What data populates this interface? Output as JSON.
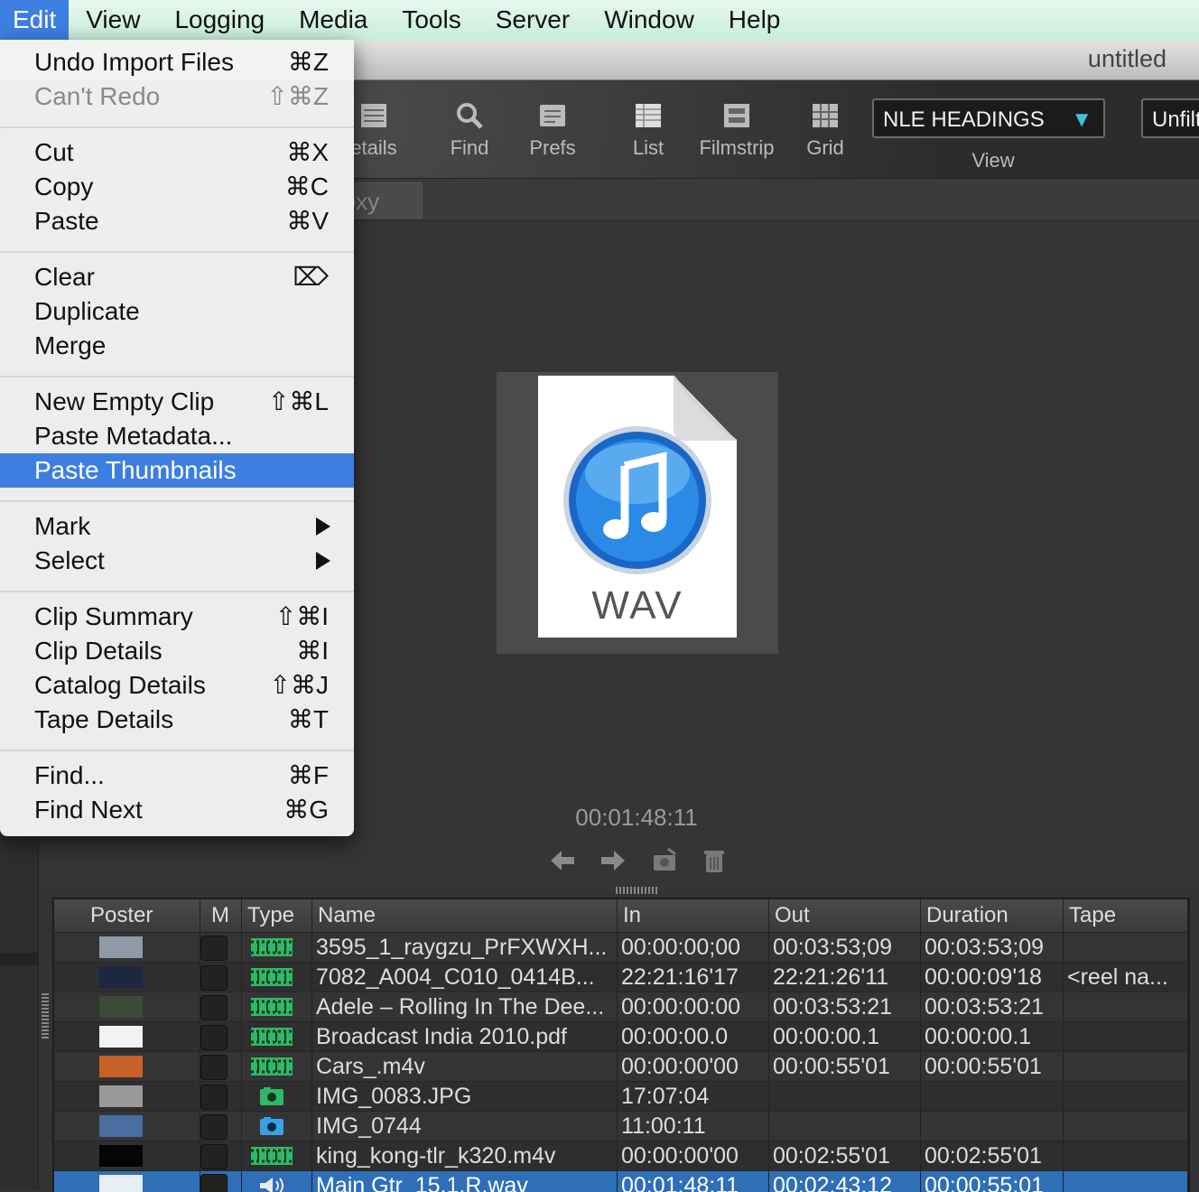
{
  "menubar": {
    "items": [
      "Edit",
      "View",
      "Logging",
      "Media",
      "Tools",
      "Server",
      "Window",
      "Help"
    ]
  },
  "window": {
    "title": "untitled"
  },
  "toolbar": {
    "tools": [
      {
        "label": "etails",
        "icon": "details-icon"
      },
      {
        "label": "Find",
        "icon": "find-icon"
      },
      {
        "label": "Prefs",
        "icon": "prefs-icon"
      },
      {
        "label": "List",
        "icon": "list-icon"
      },
      {
        "label": "Filmstrip",
        "icon": "filmstrip-icon"
      },
      {
        "label": "Grid",
        "icon": "grid-icon"
      }
    ],
    "view_select": "NLE HEADINGS",
    "view_label": "View",
    "unfilter": "Unfilt"
  },
  "tabs": {
    "proxy": "roxy"
  },
  "preview": {
    "file_type": "WAV",
    "timecode": "00:01:48:11"
  },
  "edit_menu": {
    "items": [
      {
        "label": "Undo Import Files",
        "shortcut": "⌘Z"
      },
      {
        "label": "Can't Redo",
        "shortcut": "⇧⌘Z",
        "disabled": true
      },
      {
        "label": "Cut",
        "shortcut": "⌘X"
      },
      {
        "label": "Copy",
        "shortcut": "⌘C"
      },
      {
        "label": "Paste",
        "shortcut": "⌘V"
      },
      {
        "label": "Clear",
        "shortcut": "⌦"
      },
      {
        "label": "Duplicate",
        "shortcut": ""
      },
      {
        "label": "Merge",
        "shortcut": ""
      },
      {
        "label": "New Empty Clip",
        "shortcut": "⇧⌘L"
      },
      {
        "label": "Paste Metadata...",
        "shortcut": ""
      },
      {
        "label": "Paste Thumbnails",
        "shortcut": "",
        "highlighted": true
      },
      {
        "label": "Mark",
        "submenu": true
      },
      {
        "label": "Select",
        "submenu": true
      },
      {
        "label": "Clip Summary",
        "shortcut": "⇧⌘I"
      },
      {
        "label": "Clip Details",
        "shortcut": "⌘I"
      },
      {
        "label": "Catalog Details",
        "shortcut": "⇧⌘J"
      },
      {
        "label": "Tape Details",
        "shortcut": "⌘T"
      },
      {
        "label": "Find...",
        "shortcut": "⌘F"
      },
      {
        "label": "Find Next",
        "shortcut": "⌘G"
      }
    ]
  },
  "table": {
    "columns": [
      "Poster",
      "M",
      "Type",
      "Name",
      "In",
      "Out",
      "Duration",
      "Tape"
    ],
    "rows": [
      {
        "name": "3595_1_raygzu_PrFXWXH...",
        "in": "00:00:00;00",
        "out": "00:03:53;09",
        "duration": "00:03:53;09",
        "tape": "",
        "type": "video",
        "poster": "#8e9aa8"
      },
      {
        "name": "7082_A004_C010_0414B...",
        "in": "22:21:16'17",
        "out": "22:21:26'11",
        "duration": "00:00:09'18",
        "tape": "<reel na...",
        "type": "video",
        "poster": "#1d2740"
      },
      {
        "name": "Adele – Rolling In The Dee...",
        "in": "00:00:00:00",
        "out": "00:03:53:21",
        "duration": "00:03:53:21",
        "tape": "",
        "type": "video",
        "poster": "#3c4a38"
      },
      {
        "name": "Broadcast India 2010.pdf",
        "in": "00:00:00.0",
        "out": "00:00:00.1",
        "duration": "00:00:00.1",
        "tape": "",
        "type": "video",
        "poster": "#f2f2f2"
      },
      {
        "name": "Cars_.m4v",
        "in": "00:00:00'00",
        "out": "00:00:55'01",
        "duration": "00:00:55'01",
        "tape": "",
        "type": "video",
        "poster": "#c8602a"
      },
      {
        "name": "IMG_0083.JPG",
        "in": "17:07:04",
        "out": "",
        "duration": "",
        "tape": "",
        "type": "photo",
        "poster": "#9a9a9a"
      },
      {
        "name": "IMG_0744",
        "in": "11:00:11",
        "out": "",
        "duration": "",
        "tape": "",
        "type": "photo-blue",
        "poster": "#4a6ea0"
      },
      {
        "name": "king_kong-tlr_k320.m4v",
        "in": "00:00:00'00",
        "out": "00:02:55'01",
        "duration": "00:02:55'01",
        "tape": "",
        "type": "video",
        "poster": "#050505"
      },
      {
        "name": "Main Gtr_15.1.R.wav",
        "in": "00:01:48:11",
        "out": "00:02:43:12",
        "duration": "00:00:55:01",
        "tape": "",
        "type": "audio",
        "poster": "#e8eef6",
        "selected": true
      }
    ]
  },
  "colors": {
    "accent": "#3d7fe0",
    "selected_row": "#2e6fb8"
  }
}
